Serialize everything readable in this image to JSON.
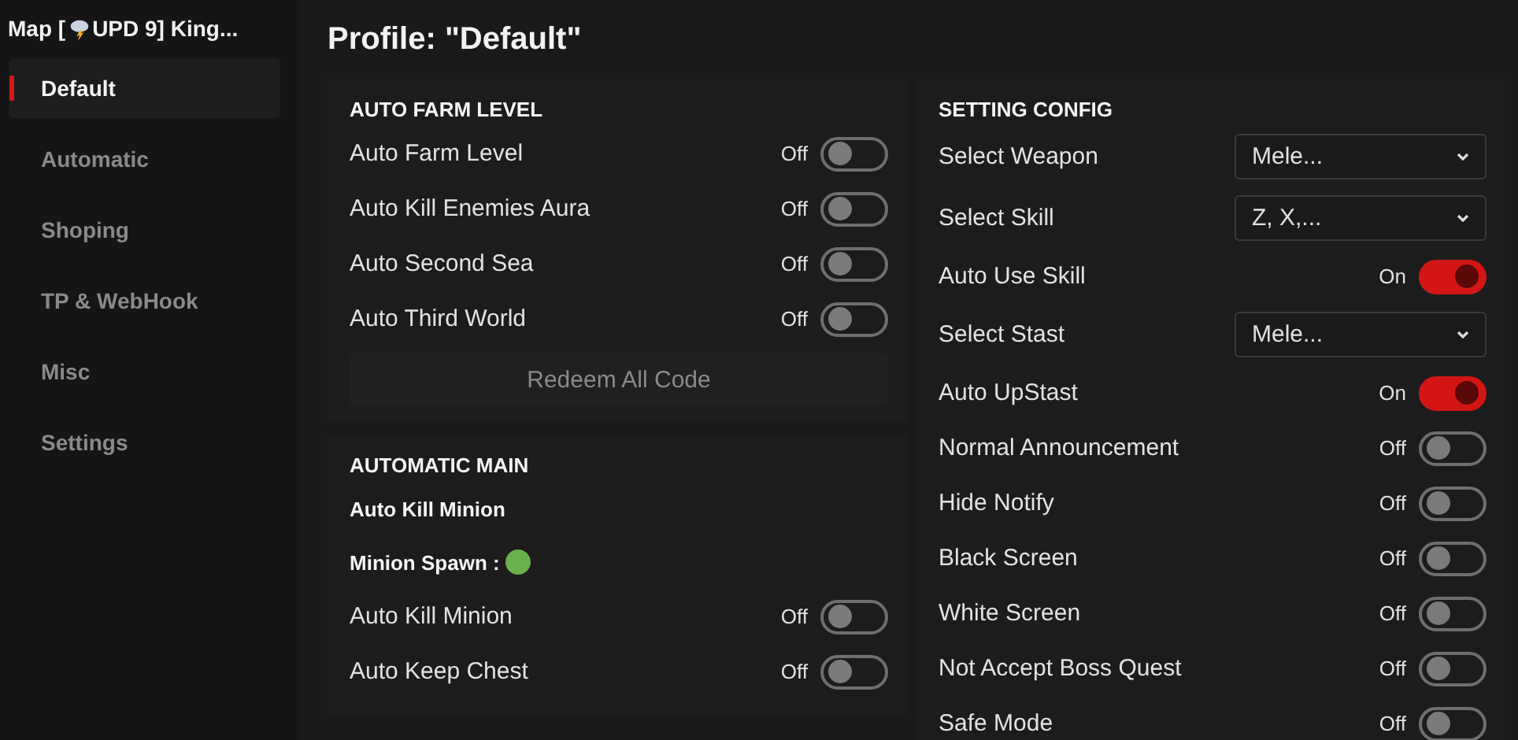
{
  "window": {
    "title_start": "Map [",
    "title_end": "UPD 9] King..."
  },
  "sidebar": {
    "items": [
      {
        "label": "Default",
        "selected": true
      },
      {
        "label": "Automatic",
        "selected": false
      },
      {
        "label": "Shoping",
        "selected": false
      },
      {
        "label": "TP & WebHook",
        "selected": false
      },
      {
        "label": "Misc",
        "selected": false
      },
      {
        "label": "Settings",
        "selected": false
      }
    ]
  },
  "profile_title": "Profile: \"Default\"",
  "left_sections": [
    {
      "heading": "AUTO FARM LEVEL",
      "rows": [
        {
          "kind": "toggle",
          "label": "Auto Farm Level",
          "state": "Off",
          "on": false
        },
        {
          "kind": "toggle",
          "label": "Auto Kill Enemies Aura",
          "state": "Off",
          "on": false
        },
        {
          "kind": "toggle",
          "label": "Auto Second Sea",
          "state": "Off",
          "on": false
        },
        {
          "kind": "toggle",
          "label": "Auto Third World",
          "state": "Off",
          "on": false
        },
        {
          "kind": "button",
          "label": "Redeem All Code"
        }
      ]
    },
    {
      "heading": "AUTOMATIC MAIN",
      "rows": [
        {
          "kind": "label",
          "label": "Auto Kill Minion"
        },
        {
          "kind": "status",
          "label": "Minion Spawn :",
          "color": "#6ab04c"
        },
        {
          "kind": "toggle",
          "label": "Auto Kill Minion",
          "state": "Off",
          "on": false
        },
        {
          "kind": "toggle",
          "label": "Auto Keep Chest",
          "state": "Off",
          "on": false
        }
      ]
    }
  ],
  "right_section": {
    "heading": "SETTING CONFIG",
    "rows": [
      {
        "kind": "dropdown",
        "label": "Select Weapon",
        "value": "Mele..."
      },
      {
        "kind": "dropdown",
        "label": "Select Skill",
        "value": "Z, X,..."
      },
      {
        "kind": "toggle",
        "label": "Auto Use Skill",
        "state": "On",
        "on": true
      },
      {
        "kind": "dropdown",
        "label": "Select Stast",
        "value": "Mele..."
      },
      {
        "kind": "toggle",
        "label": "Auto UpStast",
        "state": "On",
        "on": true
      },
      {
        "kind": "toggle",
        "label": "Normal Announcement",
        "state": "Off",
        "on": false
      },
      {
        "kind": "toggle",
        "label": "Hide Notify",
        "state": "Off",
        "on": false
      },
      {
        "kind": "toggle",
        "label": "Black Screen",
        "state": "Off",
        "on": false
      },
      {
        "kind": "toggle",
        "label": "White Screen",
        "state": "Off",
        "on": false
      },
      {
        "kind": "toggle",
        "label": "Not Accept Boss Quest",
        "state": "Off",
        "on": false
      },
      {
        "kind": "toggle",
        "label": "Safe Mode",
        "state": "Off",
        "on": false
      }
    ]
  }
}
